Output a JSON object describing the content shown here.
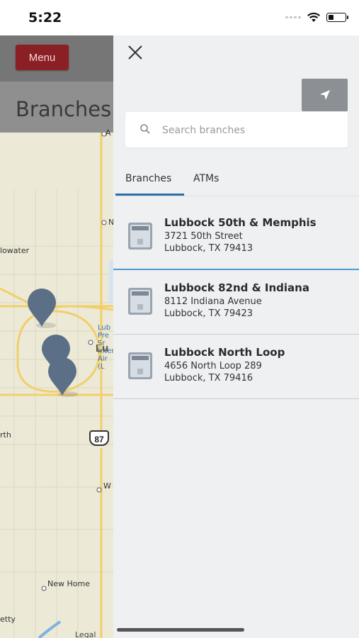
{
  "status_bar": {
    "time": "5:22"
  },
  "background": {
    "menu_label": "Menu",
    "page_title": "Branches",
    "map": {
      "labels": {
        "bellwater": "lowater",
        "shallowater_top": "A",
        "north_marker": "N",
        "city": "Lu",
        "airport": [
          "Lub",
          "Pre",
          "Sr",
          "Intern",
          "Air",
          "(L"
        ],
        "abernathy": "rth",
        "wolfforth_w": "W",
        "new_home": "New Home",
        "slaton": "etty",
        "highway": "87",
        "legal": "Legal"
      }
    }
  },
  "panel": {
    "close_icon": "close-icon",
    "locate_icon": "location-arrow-icon",
    "search": {
      "placeholder": "Search branches"
    },
    "tabs": [
      {
        "label": "Branches",
        "active": true
      },
      {
        "label": "ATMs",
        "active": false
      }
    ],
    "branches": [
      {
        "name": "Lubbock 50th & Memphis",
        "address1": "3721 50th Street",
        "address2": "Lubbock, TX 79413",
        "selected": true
      },
      {
        "name": "Lubbock 82nd & Indiana",
        "address1": "8112 Indiana Avenue",
        "address2": "Lubbock, TX 79423",
        "selected": false
      },
      {
        "name": "Lubbock North Loop",
        "address1": "4656 North Loop 289",
        "address2": "Lubbock, TX 79416",
        "selected": false
      }
    ]
  },
  "colors": {
    "menu_button": "#8a2025",
    "tab_accent": "#2f6fa8",
    "selected_divider": "#4a9ad8",
    "panel_bg": "#eef0f1",
    "map_bg": "#ece9d6",
    "pin": "#5b6f86"
  }
}
